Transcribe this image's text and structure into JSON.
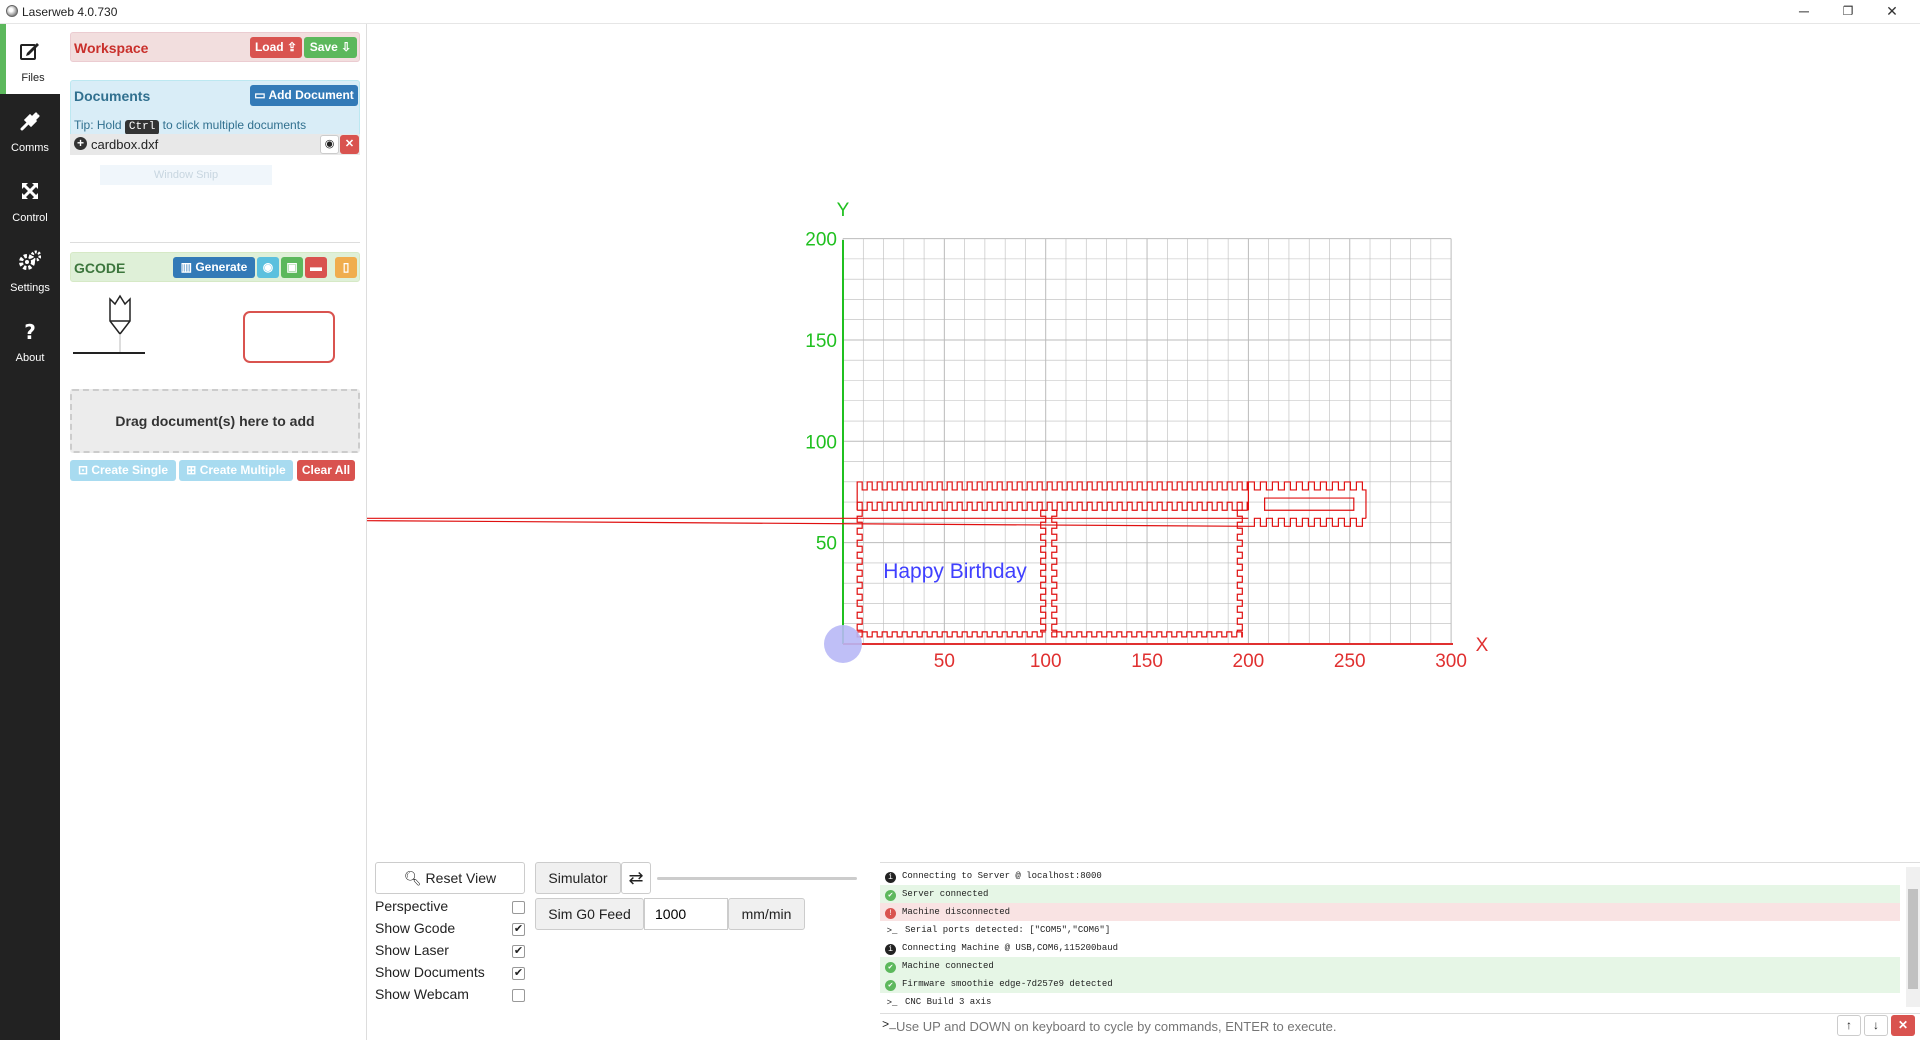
{
  "window": {
    "title": "Laserweb 4.0.730",
    "minimize": "─",
    "restore": "❐",
    "close": "✕"
  },
  "nav": [
    {
      "label": "Files",
      "icon": "edit-icon"
    },
    {
      "label": "Comms",
      "icon": "plug-icon"
    },
    {
      "label": "Control",
      "icon": "arrows-icon"
    },
    {
      "label": "Settings",
      "icon": "gears-icon"
    },
    {
      "label": "About",
      "icon": "question-icon"
    }
  ],
  "workspace": {
    "title": "Workspace",
    "load_label": "Load",
    "save_label": "Save"
  },
  "documents": {
    "title": "Documents",
    "add_label": "Add Document",
    "tip_prefix": "Tip: Hold",
    "tip_key": "Ctrl",
    "tip_suffix": "to click multiple documents",
    "items": [
      {
        "name": "cardbox.dxf"
      }
    ],
    "ghost_label": "Window Snip"
  },
  "gcode": {
    "title": "GCODE",
    "generate_label": "Generate",
    "drop_text": "Drag document(s) here to add",
    "create_single_label": "Create Single",
    "create_multiple_label": "Create Multiple",
    "clear_all_label": "Clear All"
  },
  "viewport": {
    "x_axis_label": "X",
    "y_axis_label": "Y",
    "x_ticks": [
      "50",
      "100",
      "150",
      "200",
      "250",
      "300"
    ],
    "y_ticks": [
      "50",
      "100",
      "150",
      "200"
    ],
    "document_text": "Happy Birthday",
    "colors": {
      "x_axis": "#e03030",
      "y_axis": "#20c020",
      "grid": "#bbbbbb",
      "cut": "#e01010",
      "text": "#4040ff"
    }
  },
  "view_controls": {
    "reset_label": "Reset View",
    "options": [
      {
        "label": "Perspective",
        "checked": false,
        "mark": ""
      },
      {
        "label": "Show Gcode",
        "checked": true,
        "mark": "✔"
      },
      {
        "label": "Show Laser",
        "checked": true,
        "mark": "✔"
      },
      {
        "label": "Show Documents",
        "checked": true,
        "mark": "✔"
      },
      {
        "label": "Show Webcam",
        "checked": false,
        "mark": ""
      }
    ]
  },
  "simulator": {
    "label": "Simulator",
    "feed_label": "Sim G0 Feed",
    "feed_value": "1000",
    "feed_unit": "mm/min"
  },
  "console": {
    "lines": [
      {
        "type": "info",
        "text": "Connecting to Server @ localhost:8000"
      },
      {
        "type": "ok",
        "text": "Server connected"
      },
      {
        "type": "err",
        "text": "Machine disconnected"
      },
      {
        "type": "prompt",
        "text": "Serial ports detected: [\"COM5\",\"COM6\"]"
      },
      {
        "type": "info",
        "text": "Connecting Machine @ USB,COM6,115200baud"
      },
      {
        "type": "ok",
        "text": "Machine connected"
      },
      {
        "type": "ok",
        "text": "Firmware smoothie edge-7d257e9 detected"
      },
      {
        "type": "prompt",
        "text": "CNC Build 3 axis"
      }
    ],
    "input_placeholder": "Use UP and DOWN on keyboard to cycle by commands, ENTER to execute."
  }
}
